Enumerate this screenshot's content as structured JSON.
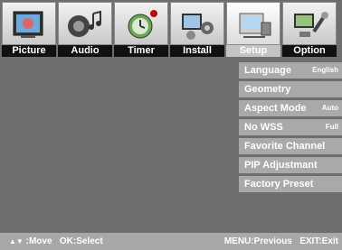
{
  "tabs": [
    {
      "label": "Picture",
      "icon": "picture-icon"
    },
    {
      "label": "Audio",
      "icon": "audio-icon"
    },
    {
      "label": "Timer",
      "icon": "timer-icon"
    },
    {
      "label": "Install",
      "icon": "install-icon"
    },
    {
      "label": "Setup",
      "icon": "setup-icon"
    },
    {
      "label": "Option",
      "icon": "option-icon"
    }
  ],
  "active_tab": "Setup",
  "menu": [
    {
      "label": "Language",
      "value": "English"
    },
    {
      "label": "Geometry",
      "value": ""
    },
    {
      "label": "Aspect Mode",
      "value": "Auto"
    },
    {
      "label": "No WSS",
      "value": "Full"
    },
    {
      "label": "Favorite Channel",
      "value": ""
    },
    {
      "label": "PIP Adjustmant",
      "value": ""
    },
    {
      "label": "Factory Preset",
      "value": ""
    }
  ],
  "footer": {
    "move_arrows": "▲▼",
    "move_label": ":Move",
    "select_label": "OK:Select",
    "previous_label": "MENU:Previous",
    "exit_label": "EXIT:Exit"
  },
  "colors": {
    "background": "#6e6e6e",
    "menu_item": "#a9a9a9",
    "tab_label_bg": "#111111",
    "active_tab_label_bg": "#c4c4c4"
  }
}
